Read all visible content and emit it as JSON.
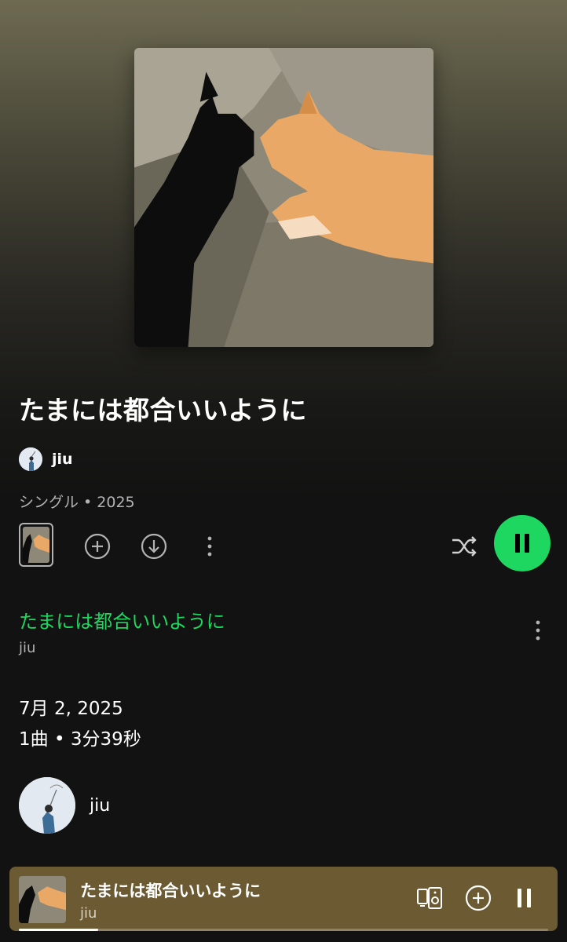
{
  "album": {
    "title": "たまには都合いいように",
    "artist": "jiu",
    "meta": "シングル • 2025",
    "cover_icon": "cats-album-art-image"
  },
  "actions": {
    "add_icon": "plus-circle-icon",
    "download_icon": "download-circle-icon",
    "more_icon": "more-vertical-icon",
    "shuffle_icon": "shuffle-icon",
    "pause_icon": "pause-icon"
  },
  "track": {
    "title": "たまには都合いいように",
    "artist": "jiu"
  },
  "release": {
    "date": "7月 2, 2025",
    "summary": "1曲 • 3分39秒"
  },
  "artist_card": {
    "name": "jiu"
  },
  "mini_player": {
    "title": "たまには都合いいように",
    "artist": "jiu",
    "progress": 0.15
  },
  "colors": {
    "accent": "#1ed760",
    "background": "#121212",
    "mini_player_bg": "#6b5a32",
    "secondary_text": "#b3b3b3"
  }
}
